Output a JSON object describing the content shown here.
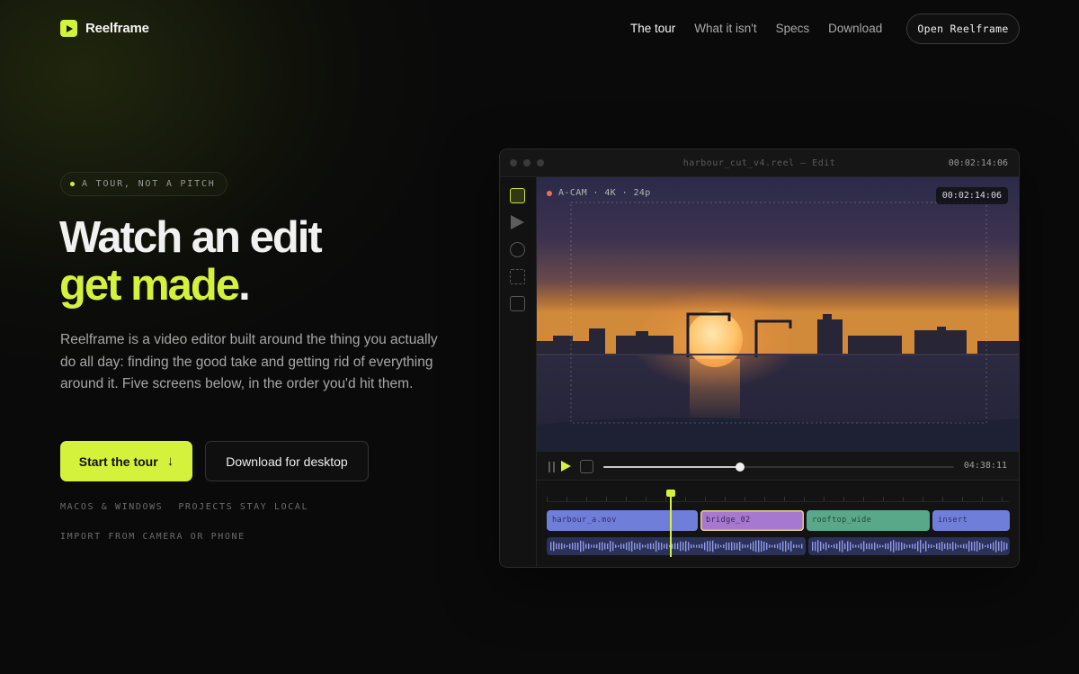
{
  "brand": {
    "name": "Reelframe",
    "accent": "#d4f23c"
  },
  "nav": {
    "items": [
      {
        "label": "The tour",
        "active": true
      },
      {
        "label": "What it isn't",
        "active": false
      },
      {
        "label": "Specs",
        "active": false
      },
      {
        "label": "Download",
        "active": false
      }
    ],
    "cta": "Open Reelframe"
  },
  "hero": {
    "eyebrow": "A TOUR, NOT A PITCH",
    "headline_line1": "Watch an edit",
    "headline_line2": "get made",
    "headline_period": ".",
    "lead": "Reelframe is a video editor built around the thing you actually do all day: finding the good take and getting rid of everything around it. Five screens below, in the order you'd hit them.",
    "primary_button": "Start the tour",
    "primary_icon": "arrow-down-icon",
    "secondary_button": "Download for desktop",
    "meta": [
      "MACOS & WINDOWS",
      "PROJECTS STAY LOCAL",
      "IMPORT FROM CAMERA OR PHONE"
    ]
  },
  "editor": {
    "window_title": "harbour_cut_v4.reel — Edit",
    "window_time": "00:02:14:06",
    "tools": [
      "select-tool-icon",
      "play-tool-icon",
      "circle-tool-icon",
      "marquee-tool-icon",
      "box-tool-icon"
    ],
    "viewer": {
      "camera_label": "A-CAM · 4K · 24p",
      "timecode": "00:02:14:06",
      "record_color": "#f06d5a"
    },
    "transport": {
      "duration": "04:38:11",
      "progress": 0.39
    },
    "clips": [
      {
        "label": "harbour_a.mov",
        "color": "#6f7fd9",
        "text": "#2a2f66"
      },
      {
        "label": "bridge_02",
        "color": "#a678d0",
        "text": "#3d2456",
        "selected": true
      },
      {
        "label": "rooftop_wide",
        "color": "#5aa88a",
        "text": "#1f4a3a"
      },
      {
        "label": "insert",
        "color": "#6f7fd9",
        "text": "#2a2f66"
      }
    ]
  }
}
